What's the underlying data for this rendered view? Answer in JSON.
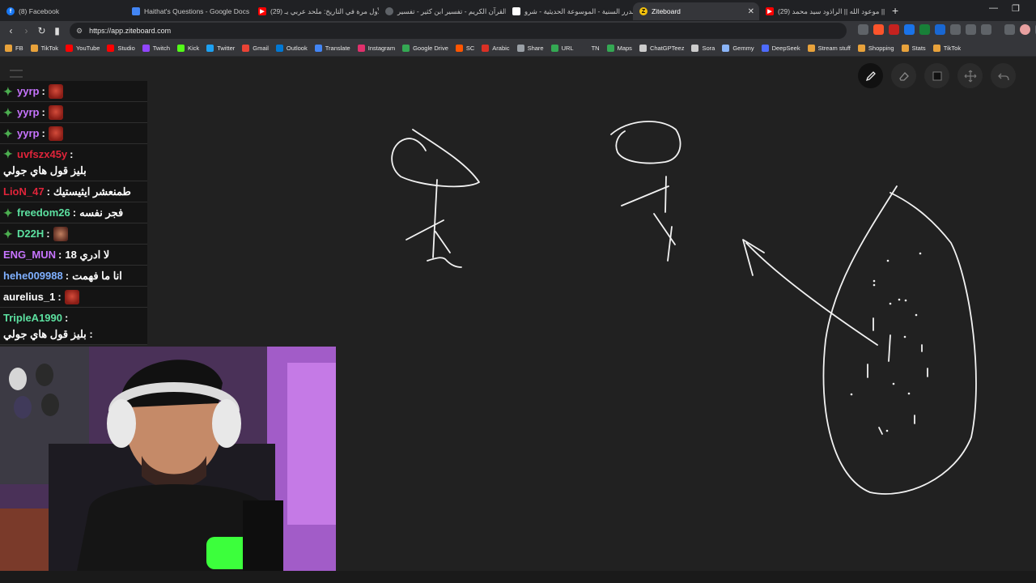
{
  "tabs": [
    {
      "title": "(8) Facebook",
      "icon": "facebook-icon",
      "color": "#1877f2"
    },
    {
      "title": "Haithat's Questions - Google Docs",
      "icon": "google-docs-icon",
      "color": "#4285f4"
    },
    {
      "title": "(29) لأول مرة في التاريخ: ملحد عربي يـ",
      "icon": "youtube-icon",
      "color": "#ff0000"
    },
    {
      "title": "القرآن الكريم - تفسير ابن كثير - تفسير ...",
      "icon": "globe-icon",
      "color": "#9aa0a6"
    },
    {
      "title": "الدرر السنية - الموسوعة الحديثية - شرو..",
      "icon": "page-icon",
      "color": "#ffffff"
    },
    {
      "title": "Ziteboard",
      "icon": "ziteboard-icon",
      "color": "#f4c20d"
    },
    {
      "title": "(29) موعود الله || الراذود سيد محمد ||",
      "icon": "youtube-icon",
      "color": "#ff0000"
    }
  ],
  "address": {
    "url": "https://app.ziteboard.com"
  },
  "bookmarks": [
    {
      "label": "FB",
      "color": "#e8a23b"
    },
    {
      "label": "TikTok",
      "color": "#e8a23b"
    },
    {
      "label": "YouTube",
      "color": "#ff0000"
    },
    {
      "label": "Studio",
      "color": "#ff0000"
    },
    {
      "label": "Twitch",
      "color": "#9146ff"
    },
    {
      "label": "Kick",
      "color": "#53fc18"
    },
    {
      "label": "Twitter",
      "color": "#1da1f2"
    },
    {
      "label": "Gmail",
      "color": "#ea4335"
    },
    {
      "label": "Outlook",
      "color": "#0078d4"
    },
    {
      "label": "Translate",
      "color": "#4285f4"
    },
    {
      "label": "Instagram",
      "color": "#e1306c"
    },
    {
      "label": "Google Drive",
      "color": "#34a853"
    },
    {
      "label": "SC",
      "color": "#ff5500"
    },
    {
      "label": "Arabic",
      "color": "#d93025"
    },
    {
      "label": "Share",
      "color": "#9aa0a6"
    },
    {
      "label": "URL",
      "color": "#34a853"
    },
    {
      "label": "TN",
      "color": "#35363a"
    },
    {
      "label": "Maps",
      "color": "#34a853"
    },
    {
      "label": "ChatGPTeez",
      "color": "#cccccc"
    },
    {
      "label": "Sora",
      "color": "#cccccc"
    },
    {
      "label": "Gemmy",
      "color": "#8ab4f8"
    },
    {
      "label": "DeepSeek",
      "color": "#4d6bfe"
    },
    {
      "label": "Stream stuff",
      "color": "#e8a23b"
    },
    {
      "label": "Shopping",
      "color": "#e8a23b"
    },
    {
      "label": "Stats",
      "color": "#e8a23b"
    },
    {
      "label": "TikTok",
      "color": "#e8a23b"
    }
  ],
  "chat": [
    {
      "user": "yyrp",
      "color": "#c774ff",
      "badge": true,
      "msg": "",
      "emote": "red"
    },
    {
      "user": "yyrp",
      "color": "#c774ff",
      "badge": true,
      "msg": "",
      "emote": "red"
    },
    {
      "user": "yyrp",
      "color": "#c774ff",
      "badge": true,
      "msg": "",
      "emote": "red"
    },
    {
      "user": "uvfszx45y",
      "color": "#e0243a",
      "badge": true,
      "msg": "بليز قول هاي جولي",
      "emote": ""
    },
    {
      "user": "LioN_47",
      "color": "#e0243a",
      "badge": false,
      "msg": "طمنعشر ايثيستيك",
      "emote": ""
    },
    {
      "user": "freedom26",
      "color": "#5ce0a0",
      "badge": true,
      "msg": "فجر نفسه",
      "emote": ""
    },
    {
      "user": "D22H",
      "color": "#5ce0a0",
      "badge": true,
      "msg": "",
      "emote": "face"
    },
    {
      "user": "ENG_MUN",
      "color": "#c774ff",
      "badge": false,
      "msg": "لا ادري 18",
      "emote": ""
    },
    {
      "user": "hehe009988",
      "color": "#7fb0ff",
      "badge": false,
      "msg": "انا ما فهمت",
      "emote": ""
    },
    {
      "user": "aurelius_1",
      "color": "#ffffff",
      "badge": false,
      "msg": "",
      "emote": "red"
    },
    {
      "user": "TripleA1990",
      "color": "#5ce0a0",
      "badge": false,
      "msg": ": بليز قول هاي جولي",
      "emote": ""
    }
  ],
  "colors": {
    "canvas": "#212121",
    "stroke": "#f2f2f2",
    "chat_badge": "#4caf50"
  }
}
